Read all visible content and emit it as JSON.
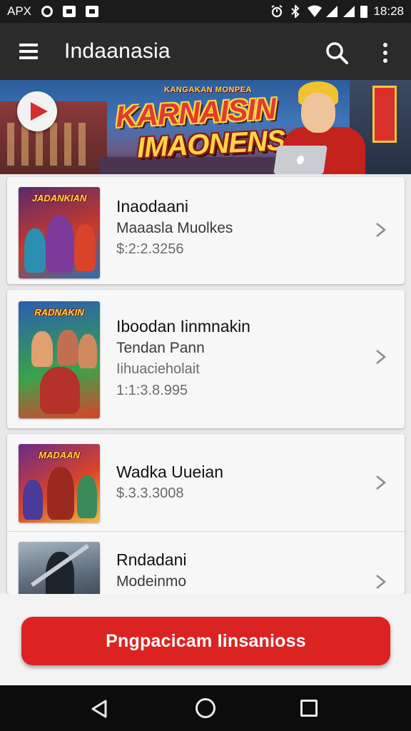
{
  "status_bar": {
    "left_label": "APX",
    "time": "18:28",
    "icons": [
      "sync-circle-icon",
      "notification-box-icon",
      "notification-box-icon",
      "alarm-icon",
      "bluetooth-icon",
      "wifi-icon",
      "signal-icon",
      "signal-icon",
      "battery-icon"
    ]
  },
  "app_bar": {
    "title": "Indaanasia",
    "icons": [
      "menu-icon",
      "search-icon",
      "more-vert-icon"
    ]
  },
  "banner": {
    "subtitle": "KANGAKAN MONPEA",
    "title_line1": "KARNAISIN",
    "title_line2": "IMAONENS"
  },
  "items": [
    {
      "title": "Inaodaani",
      "subtitle": "Maaasla Muolkes",
      "lines": [
        "$:2:2.3256"
      ],
      "thumb_text": "JADANKIAN",
      "thumb_colors": [
        "#5a2a6e",
        "#c73a2a",
        "#2a6fb0"
      ]
    },
    {
      "title": "Iboodan Iinmnakin",
      "subtitle": "Tendan Pann",
      "lines": [
        "Iihuacieholait",
        "1:1:3.8.995"
      ],
      "thumb_text": "RADNAKIN",
      "thumb_colors": [
        "#2a5fb0",
        "#3aa34a",
        "#d9432a"
      ]
    },
    {
      "title": "Wadka Uueian",
      "subtitle": "",
      "lines": [
        "$.3.3.3008"
      ],
      "thumb_text": "MADAAN",
      "thumb_colors": [
        "#6a2a8a",
        "#d9432a",
        "#f0c040"
      ]
    },
    {
      "title": "Rndadani",
      "subtitle": "Modeinmo",
      "lines": [],
      "thumb_text": "",
      "thumb_colors": [
        "#5d6b7a",
        "#2e3740",
        "#a7b4c2"
      ]
    }
  ],
  "cta": {
    "label": "Pngpacicam Iinsanioss",
    "color": "#db2422"
  },
  "nav_bar": {
    "icons": [
      "back-icon",
      "home-icon",
      "recents-icon"
    ]
  }
}
